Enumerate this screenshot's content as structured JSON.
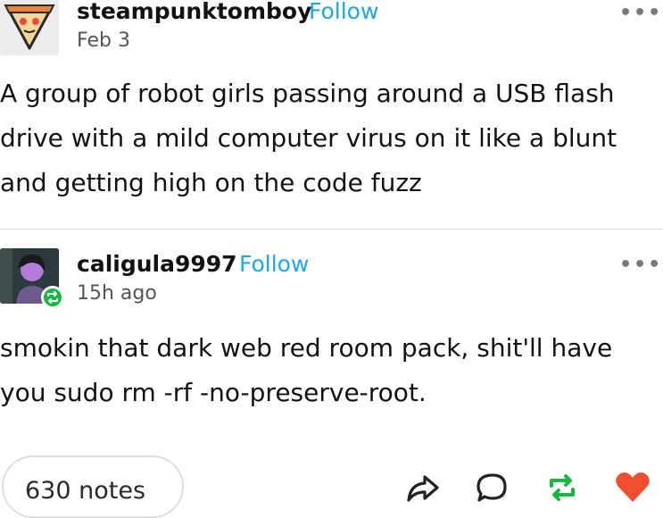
{
  "post": {
    "author": "steampunktomboy",
    "follow_label": "Follow",
    "date": "Feb 3",
    "text": "A group of robot girls passing around a USB flash drive with a mild computer virus on it like a blunt and getting high on the code fuzz",
    "more_label": "•••"
  },
  "reblog": {
    "author": "caligula9997",
    "follow_label": "Follow",
    "date": "15h ago",
    "text": "smokin that dark web red room pack, shit'll have you sudo rm -rf -no-preserve-root.",
    "more_label": "•••"
  },
  "footer": {
    "notes_label": "630 notes",
    "icons": [
      "share-icon",
      "reply-icon",
      "reblog-icon",
      "like-icon"
    ],
    "colors": {
      "reblog": "#16b83f",
      "like": "#f04e2f",
      "follow": "#1ea7e3"
    }
  }
}
